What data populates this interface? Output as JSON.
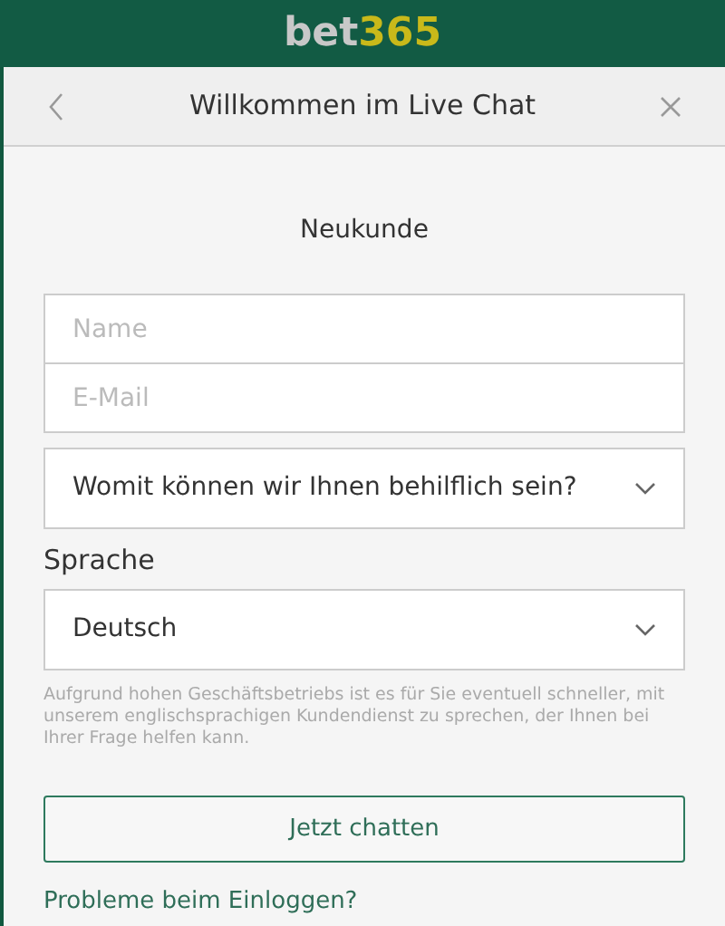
{
  "logo": {
    "part_1": "bet",
    "part_2": "365"
  },
  "panel": {
    "title": "Willkommen im Live Chat"
  },
  "form": {
    "heading": "Neukunde",
    "fields": [
      {
        "placeholder": "Name"
      },
      {
        "placeholder": "E-Mail"
      }
    ],
    "topic_select": {
      "value": "Womit können wir Ihnen behilflich sein?"
    },
    "language_label": "Sprache",
    "language_select": {
      "value": "Deutsch"
    },
    "notice": "Aufgrund hohen Geschäftsbetriebs ist es für Sie eventuell schneller, mit unserem englischsprachigen Kundendienst zu sprechen, der Ihnen bei Ihrer Frage helfen kann.",
    "submit": "Jetzt chatten",
    "login_link": "Probleme beim Einloggen?"
  }
}
